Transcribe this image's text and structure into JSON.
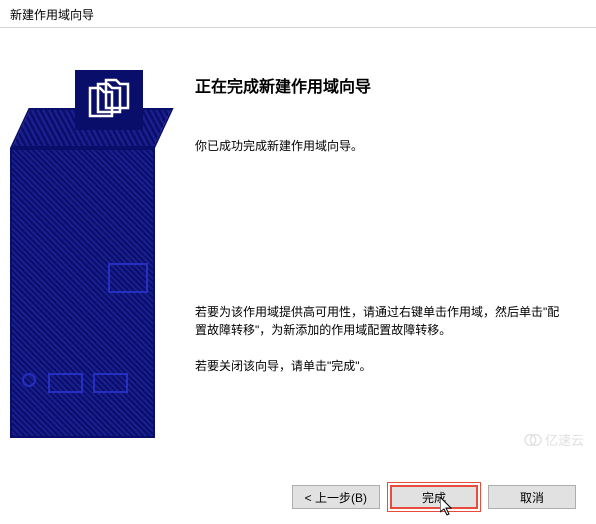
{
  "window": {
    "title": "新建作用域向导"
  },
  "main": {
    "heading": "正在完成新建作用域向导",
    "success_text": "你已成功完成新建作用域向导。",
    "availability_text": "若要为该作用域提供高可用性，请通过右键单击作用域，然后单击\"配置故障转移\"，为新添加的作用域配置故障转移。",
    "close_text": "若要关闭该向导，请单击\"完成\"。"
  },
  "buttons": {
    "back": "< 上一步(B)",
    "finish": "完成",
    "cancel": "取消"
  },
  "watermark": {
    "text": "亿速云"
  }
}
